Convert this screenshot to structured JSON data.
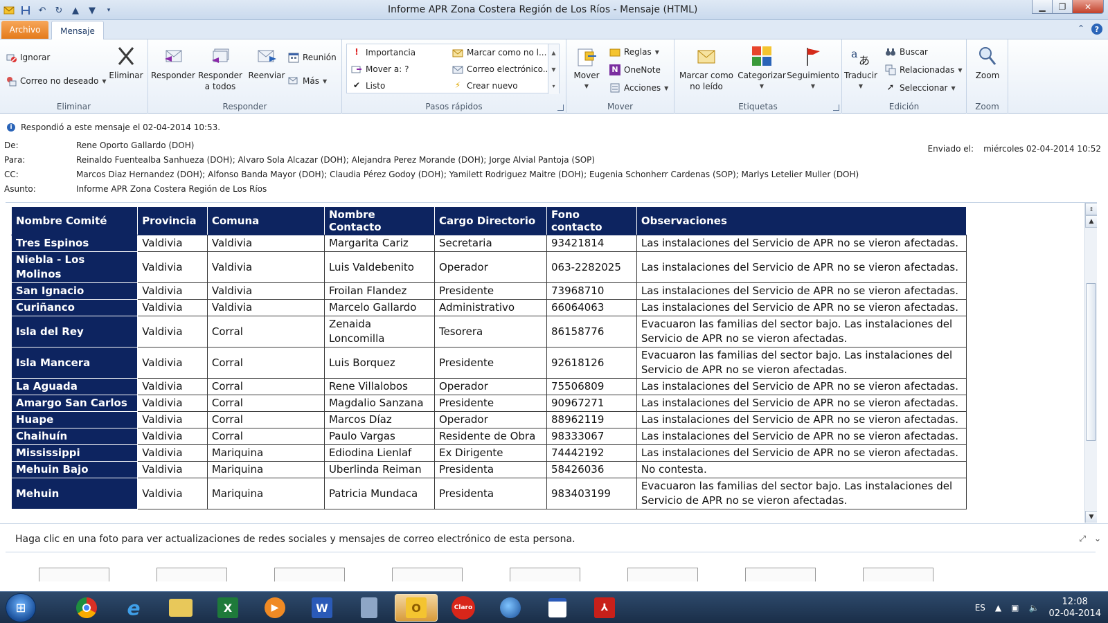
{
  "window": {
    "title": "Informe APR Zona Costera Región de Los Ríos  -  Mensaje (HTML)",
    "minimize": "▁",
    "maximize": "❐",
    "close": "✕"
  },
  "tabs": {
    "archivo": "Archivo",
    "mensaje": "Mensaje"
  },
  "ribbon": {
    "eliminar": {
      "label": "Eliminar",
      "ignorar": "Ignorar",
      "correo_no_deseado": "Correo no deseado",
      "eliminar_btn": "Eliminar"
    },
    "responder": {
      "label": "Responder",
      "responder": "Responder",
      "responder_todos_1": "Responder",
      "responder_todos_2": "a todos",
      "reenviar": "Reenviar",
      "reunion": "Reunión",
      "mas": "Más"
    },
    "pasos_rapidos": {
      "label": "Pasos rápidos",
      "importancia": "Importancia",
      "mover_a": "Mover a: ?",
      "listo": "Listo",
      "marcar_como": "Marcar como no l...",
      "correo_electronico": "Correo electrónico...",
      "crear_nuevo": "Crear nuevo"
    },
    "mover": {
      "label": "Mover",
      "mover_btn": "Mover",
      "reglas": "Reglas",
      "onenote": "OneNote",
      "acciones": "Acciones"
    },
    "etiquetas": {
      "label": "Etiquetas",
      "marcar_no_leido_1": "Marcar como",
      "marcar_no_leido_2": "no leído",
      "categorizar": "Categorizar",
      "seguimiento": "Seguimiento"
    },
    "edicion": {
      "label": "Edición",
      "traducir": "Traducir",
      "buscar": "Buscar",
      "relacionadas": "Relacionadas",
      "seleccionar": "Seleccionar"
    },
    "zoom": {
      "label": "Zoom",
      "zoom_btn": "Zoom"
    }
  },
  "header": {
    "info": "Respondió a este mensaje el 02-04-2014 10:53.",
    "de_label": "De:",
    "de": "Rene Oporto Gallardo (DOH)",
    "para_label": "Para:",
    "para": "Reinaldo Fuentealba Sanhueza (DOH); Alvaro Sola Alcazar (DOH); Alejandra Perez Morande (DOH); Jorge Alvial Pantoja (SOP)",
    "cc_label": "CC:",
    "cc": "Marcos Diaz Hernandez (DOH); Alfonso Banda Mayor (DOH); Claudia Pérez Godoy (DOH); Yamilett Rodriguez Maitre (DOH); Eugenia Schonherr Cardenas (SOP); Marlys Letelier Muller (DOH)",
    "asunto_label": "Asunto:",
    "asunto": "Informe APR Zona Costera Región de Los Ríos",
    "enviado_label": "Enviado el:",
    "enviado": "miércoles 02-04-2014 10:52"
  },
  "table": {
    "headers": [
      "Nombre Comité",
      "Provincia",
      "Comuna",
      "Nombre Contacto",
      "Cargo Directorio",
      "Fono contacto",
      "Observaciones"
    ],
    "rows": [
      [
        "Tres Espinos",
        "Valdivia",
        "Valdivia",
        "Margarita Cariz",
        "Secretaria",
        "93421814",
        "Las instalaciones del Servicio de APR no se vieron afectadas."
      ],
      [
        "Niebla - Los Molinos",
        "Valdivia",
        "Valdivia",
        "Luis Valdebenito",
        "Operador",
        "063-2282025",
        "Las instalaciones del Servicio de APR no se vieron afectadas."
      ],
      [
        "San Ignacio",
        "Valdivia",
        "Valdivia",
        "Froilan Flandez",
        "Presidente",
        "73968710",
        "Las instalaciones del Servicio de APR no se vieron afectadas."
      ],
      [
        "Curiñanco",
        "Valdivia",
        "Valdivia",
        "Marcelo Gallardo",
        "Administrativo",
        "66064063",
        "Las instalaciones del Servicio de APR no se vieron afectadas."
      ],
      [
        "Isla del Rey",
        "Valdivia",
        "Corral",
        "Zenaida Loncomilla",
        "Tesorera",
        "86158776",
        "Evacuaron las familias del sector bajo. Las instalaciones del Servicio de APR no se vieron afectadas."
      ],
      [
        "Isla Mancera",
        "Valdivia",
        "Corral",
        "Luis Borquez",
        "Presidente",
        "92618126",
        "Evacuaron las familias del sector bajo. Las instalaciones del Servicio de APR no se vieron afectadas."
      ],
      [
        "La Aguada",
        "Valdivia",
        "Corral",
        "Rene Villalobos",
        "Operador",
        "75506809",
        "Las instalaciones del Servicio de APR no se vieron afectadas."
      ],
      [
        "Amargo San Carlos",
        "Valdivia",
        "Corral",
        "Magdalio Sanzana",
        "Presidente",
        "90967271",
        "Las instalaciones del Servicio de APR no se vieron afectadas."
      ],
      [
        "Huape",
        "Valdivia",
        "Corral",
        "Marcos Díaz",
        "Operador",
        "88962119",
        "Las instalaciones del Servicio de APR no se vieron afectadas."
      ],
      [
        "Chaihuín",
        "Valdivia",
        "Corral",
        "Paulo Vargas",
        "Residente de Obra",
        "98333067",
        "Las instalaciones del Servicio de APR no se vieron afectadas."
      ],
      [
        "Mississippi",
        "Valdivia",
        "Mariquina",
        "Ediodina Lienlaf",
        "Ex Dirigente",
        "74442192",
        "Las instalaciones del Servicio de APR no se vieron afectadas."
      ],
      [
        "Mehuin Bajo",
        "Valdivia",
        "Mariquina",
        "Uberlinda Reiman",
        "Presidenta",
        "58426036",
        "No contesta."
      ],
      [
        "Mehuin",
        "Valdivia",
        "Mariquina",
        "Patricia Mundaca",
        "Presidenta",
        "983403199",
        "Evacuaron las familias del sector bajo. Las instalaciones del Servicio de APR no se vieron afectadas."
      ]
    ]
  },
  "people_pane": {
    "text": "Haga clic en una foto para ver actualizaciones de redes sociales y mensajes de correo electrónico de esta persona."
  },
  "taskbar": {
    "apps": [
      "chrome",
      "internet-explorer",
      "file-explorer",
      "excel",
      "media-player",
      "word",
      "calculator",
      "outlook",
      "claro",
      "google-earth",
      "calendar",
      "acrobat"
    ],
    "claro_label": "Claro",
    "lang": "ES",
    "time": "12:08",
    "date": "02-04-2014"
  },
  "colors": {
    "table_header": "#0d2460",
    "accent_archivo": "#e47a1a"
  }
}
